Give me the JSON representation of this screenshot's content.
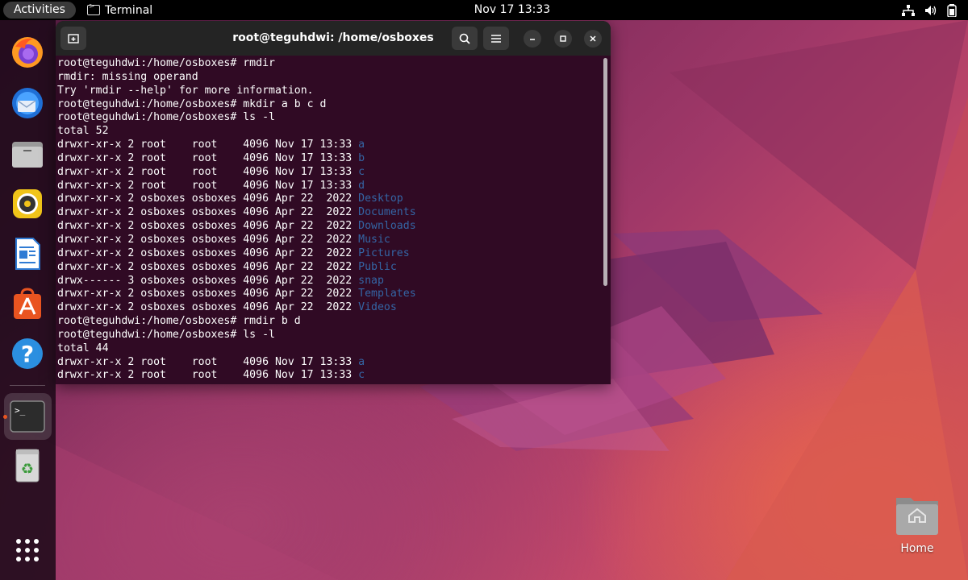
{
  "topbar": {
    "activities": "Activities",
    "app_name": "Terminal",
    "clock": "Nov 17  13:33"
  },
  "dock": {
    "apps": [
      "firefox-icon",
      "thunderbird-icon",
      "files-icon",
      "rhythmbox-icon",
      "libreoffice-writer-icon",
      "app-center-icon",
      "help-icon",
      "terminal-icon",
      "trash-icon",
      "show-apps-icon"
    ]
  },
  "terminal": {
    "title": "root@teguhdwi: /home/osboxes",
    "lines": [
      {
        "pre": "root@teguhdwi:/home/osboxes# rmdir",
        "dir": ""
      },
      {
        "pre": "rmdir: missing operand",
        "dir": ""
      },
      {
        "pre": "Try 'rmdir --help' for more information.",
        "dir": ""
      },
      {
        "pre": "root@teguhdwi:/home/osboxes# mkdir a b c d",
        "dir": ""
      },
      {
        "pre": "root@teguhdwi:/home/osboxes# ls -l",
        "dir": ""
      },
      {
        "pre": "total 52",
        "dir": ""
      },
      {
        "pre": "drwxr-xr-x 2 root    root    4096 Nov 17 13:33 ",
        "dir": "a"
      },
      {
        "pre": "drwxr-xr-x 2 root    root    4096 Nov 17 13:33 ",
        "dir": "b"
      },
      {
        "pre": "drwxr-xr-x 2 root    root    4096 Nov 17 13:33 ",
        "dir": "c"
      },
      {
        "pre": "drwxr-xr-x 2 root    root    4096 Nov 17 13:33 ",
        "dir": "d"
      },
      {
        "pre": "drwxr-xr-x 2 osboxes osboxes 4096 Apr 22  2022 ",
        "dir": "Desktop"
      },
      {
        "pre": "drwxr-xr-x 2 osboxes osboxes 4096 Apr 22  2022 ",
        "dir": "Documents"
      },
      {
        "pre": "drwxr-xr-x 2 osboxes osboxes 4096 Apr 22  2022 ",
        "dir": "Downloads"
      },
      {
        "pre": "drwxr-xr-x 2 osboxes osboxes 4096 Apr 22  2022 ",
        "dir": "Music"
      },
      {
        "pre": "drwxr-xr-x 2 osboxes osboxes 4096 Apr 22  2022 ",
        "dir": "Pictures"
      },
      {
        "pre": "drwxr-xr-x 2 osboxes osboxes 4096 Apr 22  2022 ",
        "dir": "Public"
      },
      {
        "pre": "drwx------ 3 osboxes osboxes 4096 Apr 22  2022 ",
        "dir": "snap"
      },
      {
        "pre": "drwxr-xr-x 2 osboxes osboxes 4096 Apr 22  2022 ",
        "dir": "Templates"
      },
      {
        "pre": "drwxr-xr-x 2 osboxes osboxes 4096 Apr 22  2022 ",
        "dir": "Videos"
      },
      {
        "pre": "root@teguhdwi:/home/osboxes# rmdir b d",
        "dir": ""
      },
      {
        "pre": "root@teguhdwi:/home/osboxes# ls -l",
        "dir": ""
      },
      {
        "pre": "total 44",
        "dir": ""
      },
      {
        "pre": "drwxr-xr-x 2 root    root    4096 Nov 17 13:33 ",
        "dir": "a"
      },
      {
        "pre": "drwxr-xr-x 2 root    root    4096 Nov 17 13:33 ",
        "dir": "c"
      }
    ]
  },
  "desktop": {
    "home_label": "Home"
  },
  "colors": {
    "terminal_bg": "#300a24",
    "dir_color": "#3465a4",
    "accent": "#e95420"
  }
}
